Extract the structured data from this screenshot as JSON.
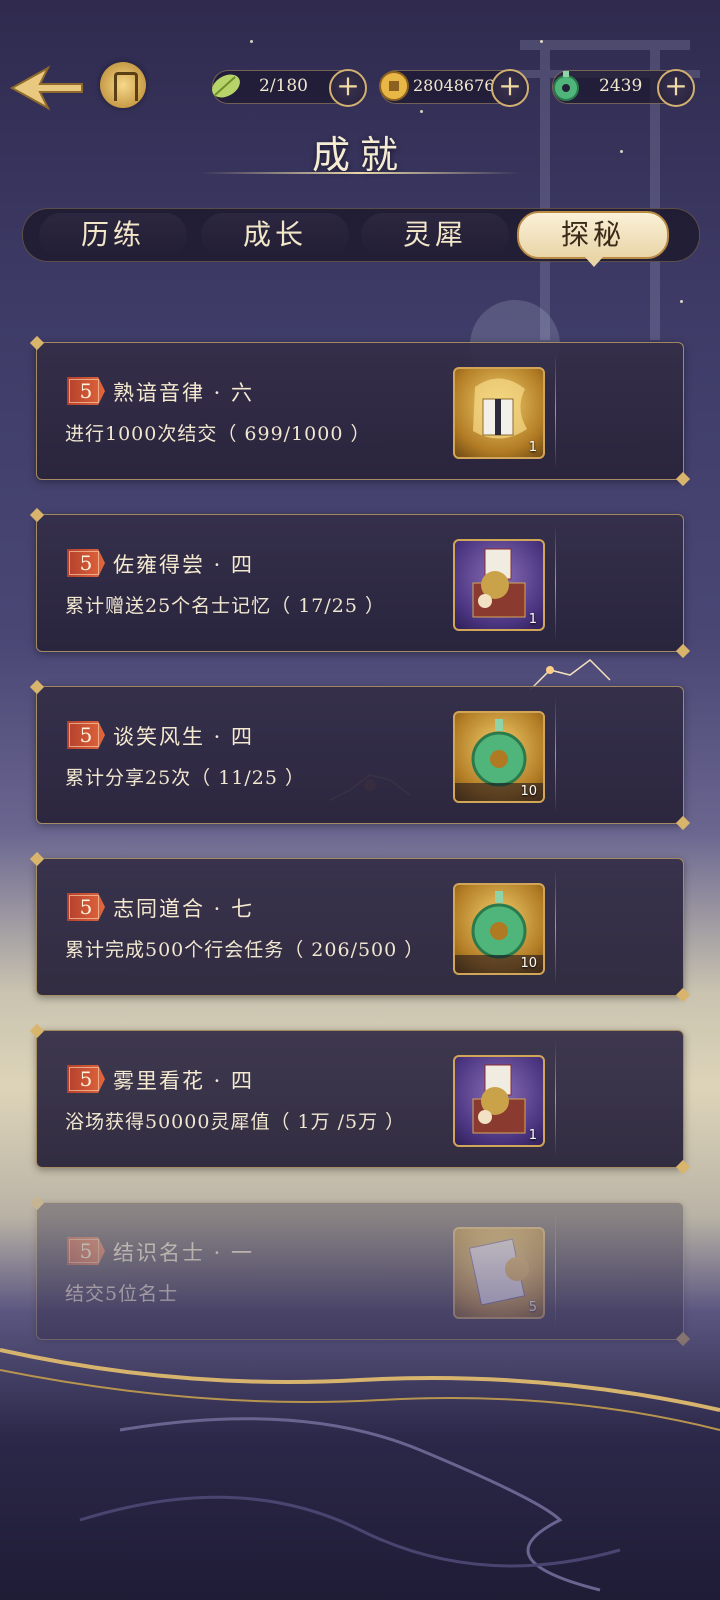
{
  "header": {
    "title": "成就",
    "resources": [
      {
        "icon": "leaf-energy-icon",
        "value": "2/180"
      },
      {
        "icon": "copper-coin-icon",
        "value": "28048676"
      },
      {
        "icon": "jade-pendant-icon",
        "value": "2439"
      }
    ],
    "add_symbol": "+"
  },
  "tabs": [
    {
      "label": "历练",
      "active": false
    },
    {
      "label": "成长",
      "active": false
    },
    {
      "label": "灵犀",
      "active": false
    },
    {
      "label": "探秘",
      "active": true
    }
  ],
  "achievements": [
    {
      "level": "5",
      "name": "熟谙音律 · 六",
      "desc": "进行1000次结交（ 699/1000 ）",
      "reward_icon": "golden-scroll-icon",
      "reward_count": "1"
    },
    {
      "level": "5",
      "name": "佐雍得尝 · 四",
      "desc": "累计赠送25个名士记忆（ 17/25 ）",
      "reward_icon": "gift-box-icon",
      "reward_count": "1"
    },
    {
      "level": "5",
      "name": "谈笑风生 · 四",
      "desc": "累计分享25次（ 11/25 ）",
      "reward_icon": "jade-pendant-icon",
      "reward_count": "10"
    },
    {
      "level": "5",
      "name": "志同道合 · 七",
      "desc": "累计完成500个行会任务（ 206/500 ）",
      "reward_icon": "jade-pendant-icon",
      "reward_count": "10"
    },
    {
      "level": "5",
      "name": "雾里看花 · 四",
      "desc": "浴场获得50000灵犀值（ 1万 /5万 ）",
      "reward_icon": "gift-box-icon",
      "reward_count": "1"
    },
    {
      "level": "5",
      "name": "结识名士 · 一",
      "desc": "结交5位名士",
      "reward_icon": "portrait-card-icon",
      "reward_count": "5"
    }
  ],
  "colors": {
    "accent_gold": "#d9b46c",
    "badge_red": "#d45a38",
    "jade": "#4fb57a"
  }
}
